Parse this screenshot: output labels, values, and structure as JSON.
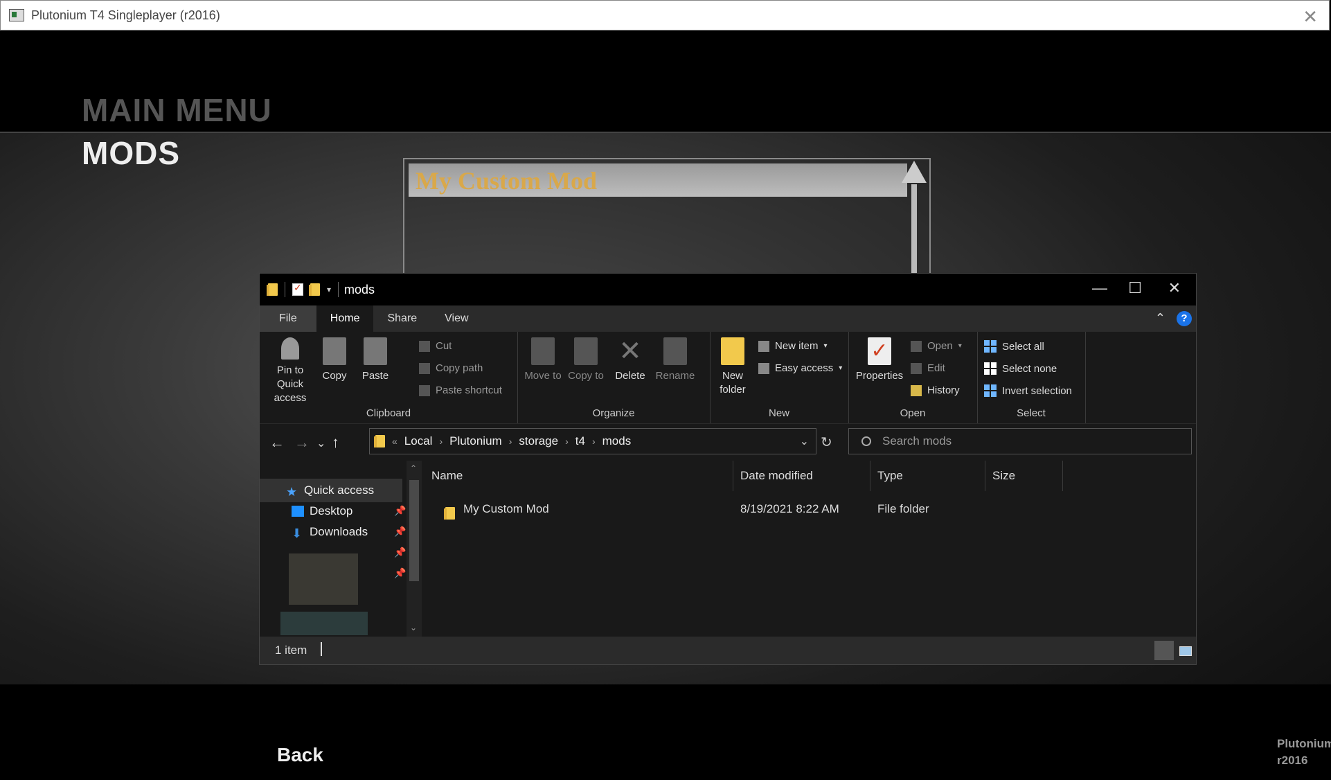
{
  "window": {
    "title": "Plutonium T4 Singleplayer (r2016)"
  },
  "game": {
    "main_menu": "MAIN MENU",
    "section": "MODS",
    "mod_list": [
      "My Custom Mod"
    ],
    "back_label": "Back",
    "brand_line1": "Plutonium",
    "brand_line2": "r2016"
  },
  "explorer": {
    "title": "mods",
    "tabs": [
      "File",
      "Home",
      "Share",
      "View"
    ],
    "ribbon": {
      "clipboard": {
        "label": "Clipboard",
        "pin": "Pin to Quick access",
        "copy": "Copy",
        "paste": "Paste",
        "cut": "Cut",
        "copy_path": "Copy path",
        "paste_shortcut": "Paste shortcut"
      },
      "organize": {
        "label": "Organize",
        "move_to": "Move to",
        "copy_to": "Copy to",
        "delete": "Delete",
        "rename": "Rename"
      },
      "new": {
        "label": "New",
        "new_folder": "New folder",
        "new_item": "New item",
        "easy_access": "Easy access"
      },
      "open": {
        "label": "Open",
        "properties": "Properties",
        "open": "Open",
        "edit": "Edit",
        "history": "History"
      },
      "select": {
        "label": "Select",
        "select_all": "Select all",
        "select_none": "Select none",
        "invert": "Invert selection"
      }
    },
    "address": {
      "crumbs": [
        "Local",
        "Plutonium",
        "storage",
        "t4",
        "mods"
      ],
      "overflow": "«"
    },
    "search_placeholder": "Search mods",
    "nav": {
      "quick_access": "Quick access",
      "desktop": "Desktop",
      "downloads": "Downloads"
    },
    "columns": [
      "Name",
      "Date modified",
      "Type",
      "Size"
    ],
    "files": [
      {
        "name": "My Custom Mod",
        "date": "8/19/2021 8:22 AM",
        "type": "File folder",
        "size": ""
      }
    ],
    "status": "1 item"
  }
}
